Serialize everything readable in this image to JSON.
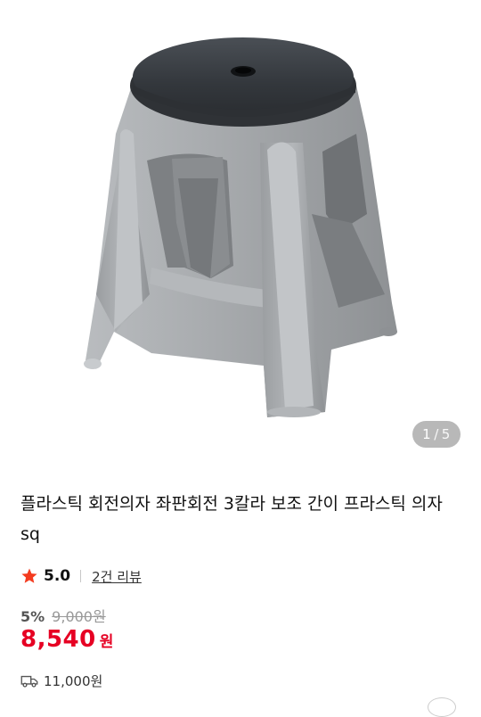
{
  "gallery": {
    "current": "1",
    "separator": "/",
    "total": "5"
  },
  "product": {
    "title": "플라스틱 회전의자 좌판회전 3칼라 보조 간이 프라스틱 의자 sq",
    "rating": "5.0",
    "review_link": "2건 리뷰",
    "discount": "5%",
    "original_price": "9,000원",
    "price": "8,540",
    "currency": "원",
    "shipping_fee": "11,000원"
  },
  "colors": {
    "price": "#e60023",
    "star": "#f43b1f",
    "stool_body": "#a6a9ac",
    "stool_seat": "#3b3f44"
  },
  "icons": {
    "rating": "star-icon",
    "shipping": "truck-icon"
  }
}
